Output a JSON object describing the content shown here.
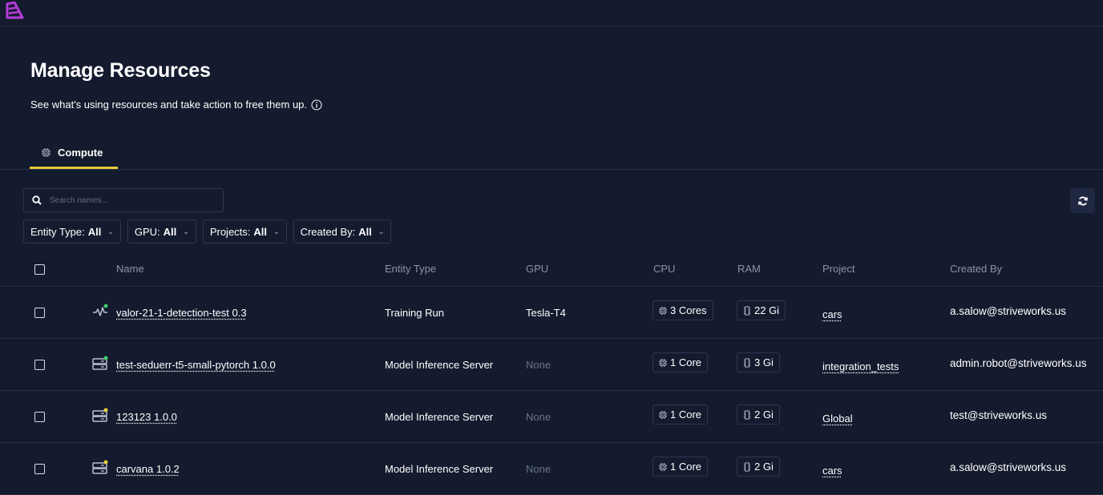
{
  "header": {
    "title": "Manage Resources",
    "subtitle": "See what's using resources and take action to free them up."
  },
  "tabs": [
    {
      "label": "Compute",
      "active": true,
      "icon": "cpu-icon"
    }
  ],
  "search": {
    "placeholder": "Search names..."
  },
  "filters": [
    {
      "label": "Entity Type:",
      "value": "All"
    },
    {
      "label": "GPU:",
      "value": "All"
    },
    {
      "label": "Projects:",
      "value": "All"
    },
    {
      "label": "Created By:",
      "value": "All"
    }
  ],
  "table": {
    "columns": [
      "Name",
      "Entity Type",
      "GPU",
      "CPU",
      "RAM",
      "Project",
      "Created By"
    ],
    "rows": [
      {
        "icon": "activity-icon",
        "status_color": "#3ecf6e",
        "name": "valor-21-1-detection-test 0.3",
        "entity_type": "Training Run",
        "gpu": "Tesla-T4",
        "gpu_muted": false,
        "cpu": "3 Cores",
        "ram": "22 Gi",
        "project": "cars",
        "created_by": "a.salow@striveworks.us"
      },
      {
        "icon": "server-icon",
        "status_color": "#3ecf6e",
        "name": "test-seduerr-t5-small-pytorch 1.0.0",
        "entity_type": "Model Inference Server",
        "gpu": "None",
        "gpu_muted": true,
        "cpu": "1 Core",
        "ram": "3 Gi",
        "project": "integration_tests",
        "created_by": "admin.robot@striveworks.us"
      },
      {
        "icon": "server-icon",
        "status_color": "#e8c93a",
        "name": "123123 1.0.0",
        "entity_type": "Model Inference Server",
        "gpu": "None",
        "gpu_muted": true,
        "cpu": "1 Core",
        "ram": "2 Gi",
        "project": "Global",
        "created_by": "test@striveworks.us"
      },
      {
        "icon": "server-icon",
        "status_color": "#e8c93a",
        "name": "carvana 1.0.2",
        "entity_type": "Model Inference Server",
        "gpu": "None",
        "gpu_muted": true,
        "cpu": "1 Core",
        "ram": "2 Gi",
        "project": "cars",
        "created_by": "a.salow@striveworks.us"
      }
    ]
  },
  "colors": {
    "background": "#141b2e",
    "accent": "#e8c93a",
    "logo": "#b43bd9"
  }
}
